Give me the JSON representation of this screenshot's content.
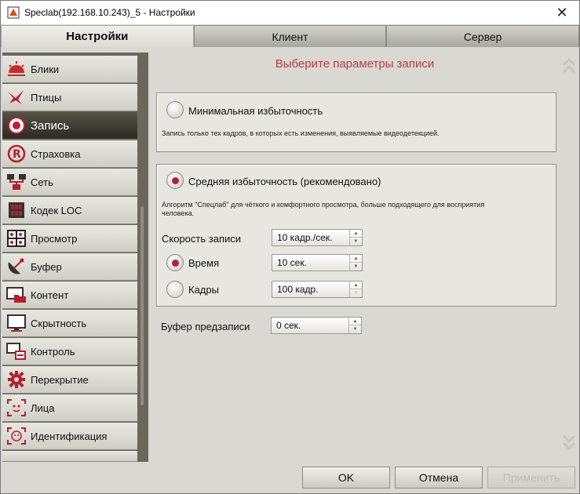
{
  "window": {
    "title": "Speclab(192.168.10.243)_5 - Настройки",
    "close_glyph": "✕"
  },
  "tabs": [
    {
      "label": "Настройки",
      "active": true
    },
    {
      "label": "Клиент",
      "active": false
    },
    {
      "label": "Сервер",
      "active": false
    }
  ],
  "sidebar": {
    "items": [
      {
        "label": "Блики",
        "icon": "sunset-icon"
      },
      {
        "label": "Птицы",
        "icon": "bird-icon"
      },
      {
        "label": "Запись",
        "icon": "record-icon",
        "active": true
      },
      {
        "label": "Страховка",
        "icon": "registered-icon"
      },
      {
        "label": "Сеть",
        "icon": "network-icon"
      },
      {
        "label": "Кодек LOC",
        "icon": "film-icon"
      },
      {
        "label": "Просмотр",
        "icon": "grid-view-icon"
      },
      {
        "label": "Буфер",
        "icon": "satellite-dish-icon"
      },
      {
        "label": "Контент",
        "icon": "folder-monitor-icon"
      },
      {
        "label": "Скрытность",
        "icon": "monitor-icon"
      },
      {
        "label": "Контроль",
        "icon": "monitor-control-icon"
      },
      {
        "label": "Перекрытие",
        "icon": "gear-icon"
      },
      {
        "label": "Лица",
        "icon": "face-icon"
      },
      {
        "label": "Идентификация",
        "icon": "face-id-icon"
      }
    ]
  },
  "main": {
    "title": "Выберите параметры записи",
    "minimal": {
      "label": "Минимальная избыточность",
      "checked": false,
      "description": "Запись только тех кадров, в которых есть изменения, выявляемые видеодетекцией."
    },
    "medium": {
      "label": "Средняя избыточность (рекомендовано)",
      "checked": true,
      "description_line1": "Алгоритм \"Спецлаб\" для чёткого и комфортного просмотра, больше подходящего для восприятия",
      "description_line2": "человека.",
      "speed_label": "Скорость записи",
      "speed_value": "10 кадр./сек.",
      "time_label": "Время",
      "time_checked": true,
      "time_value": "10 сек.",
      "frames_label": "Кадры",
      "frames_checked": false,
      "frames_value": "100 кадр."
    },
    "prebuffer": {
      "label": "Буфер предзаписи",
      "value": "0 сек."
    }
  },
  "footer": {
    "ok": "OK",
    "cancel": "Отмена",
    "apply": "Применить"
  },
  "colors": {
    "accent": "#b21e39",
    "title_red": "#b83a4b"
  }
}
